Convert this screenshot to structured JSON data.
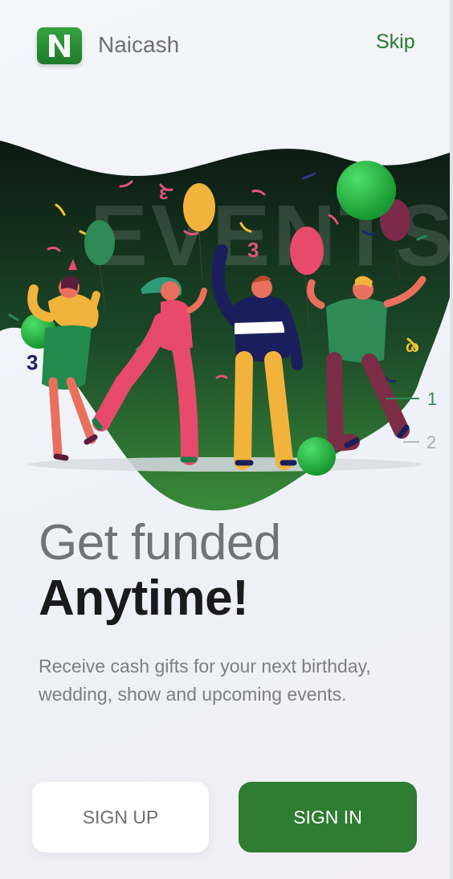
{
  "header": {
    "app_name": "Naicash",
    "logo_letter": "N",
    "skip_label": "Skip"
  },
  "illustration": {
    "backdrop_word": "EVENTS",
    "digit_left": "3",
    "marker_1": "1",
    "marker_2": "2"
  },
  "content": {
    "title_line1": "Get funded",
    "title_line2": "Anytime!",
    "description": "Receive cash gifts for your next birthday, wedding, show and upcoming events."
  },
  "actions": {
    "sign_up_label": "SIGN UP",
    "sign_in_label": "SIGN IN"
  },
  "colors": {
    "brand_green": "#2e7d32",
    "dark_green": "#0f1e16",
    "balloon_green": "#22b14c"
  }
}
